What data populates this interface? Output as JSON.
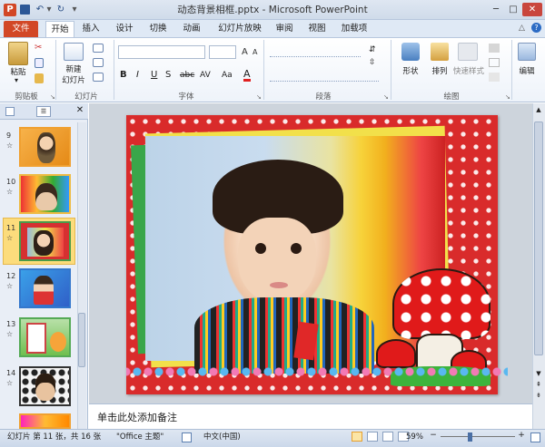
{
  "titlebar": {
    "title": "动态背景相框.pptx - Microsoft PowerPoint",
    "app_icon": "P",
    "undo": "↶",
    "redo": "↻"
  },
  "tabs": [
    "文件",
    "开始",
    "插入",
    "设计",
    "切换",
    "动画",
    "幻灯片放映",
    "审阅",
    "视图",
    "加载项"
  ],
  "ribbon": {
    "paste": "粘贴",
    "new_slide": "新建",
    "new_slide2": "幻灯片",
    "bold": "B",
    "italic": "I",
    "underline": "U",
    "strike": "S",
    "abc": "abc",
    "av": "AV",
    "aa": "Aa",
    "a": "A",
    "shapes": "形状",
    "arrange": "排列",
    "quick_styles": "快速样式",
    "edit": "编辑",
    "groups": {
      "clipboard": "剪贴板",
      "slides": "幻灯片",
      "font": "字体",
      "paragraph": "段落",
      "drawing": "绘图"
    }
  },
  "slides": {
    "numbers": [
      "9",
      "10",
      "11",
      "12",
      "13",
      "14"
    ],
    "star": "☆",
    "selected": "11"
  },
  "notes": {
    "placeholder": "单击此处添加备注"
  },
  "status": {
    "slide": "幻灯片 第 11 张，共 16 张",
    "theme": "\"Office 主题\"",
    "lang": "中文(中国)",
    "zoom": "59%"
  },
  "colors": {
    "accent": "#d24726",
    "ribbon": "#dfe9f5",
    "selected": "#fcdc7c"
  }
}
